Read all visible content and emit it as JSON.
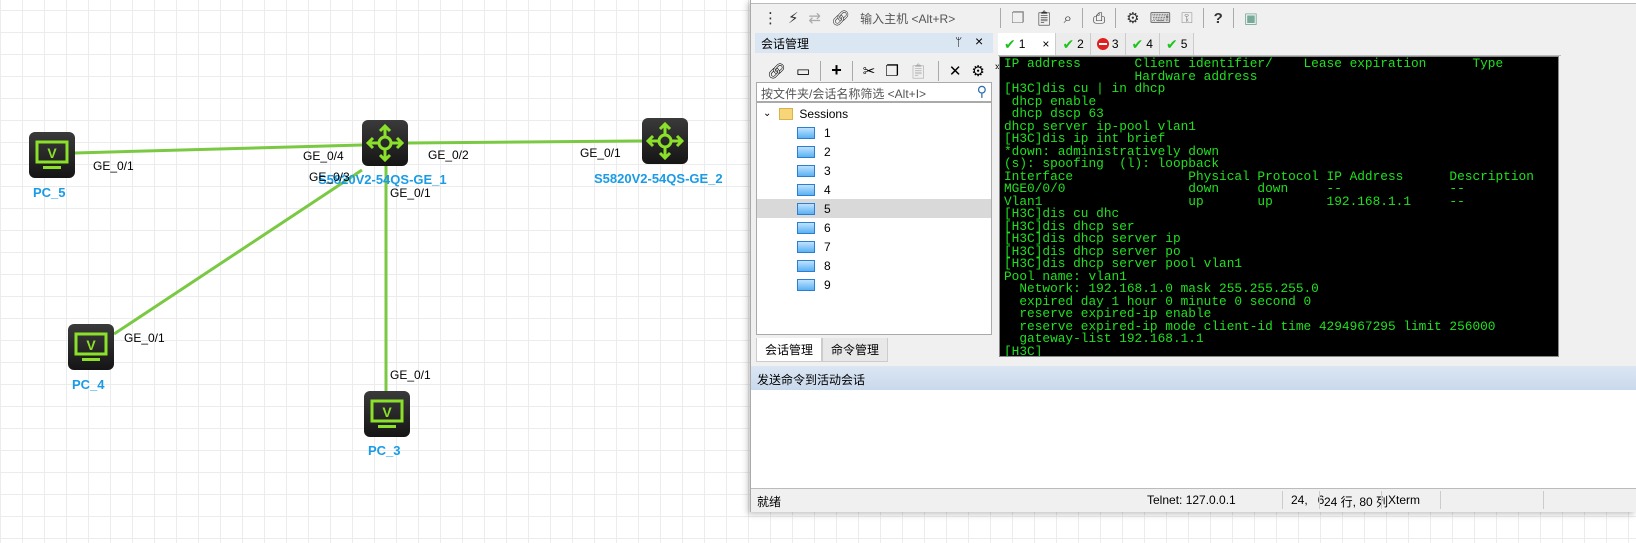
{
  "topology": {
    "nodes": [
      {
        "id": "pc5",
        "label": "PC_5",
        "type": "pc"
      },
      {
        "id": "sw1",
        "label": "S5820V2-54QS-GE_1",
        "type": "switch"
      },
      {
        "id": "sw2",
        "label": "S5820V2-54QS-GE_2",
        "type": "switch"
      },
      {
        "id": "pc4",
        "label": "PC_4",
        "type": "pc"
      },
      {
        "id": "pc3",
        "label": "PC_3",
        "type": "pc"
      }
    ],
    "ports": {
      "pc5": "GE_0/1",
      "sw1_pc5": "GE_0/4",
      "sw1_pc4": "GE_0/3",
      "sw1_sw2": "GE_0/2",
      "sw2": "GE_0/1",
      "sw1_pc3": "GE_0/1",
      "pc4": "GE_0/1",
      "pc3": "GE_0/1"
    },
    "link_color": "#7ac943"
  },
  "toolbar": {
    "host_placeholder": "输入主机 <Alt+R>"
  },
  "session_panel": {
    "title": "会话管理",
    "pin": "ᛘ",
    "close": "×",
    "more": "»",
    "filter_placeholder": "按文件夹/会话名称筛选 <Alt+I>",
    "root": "Sessions",
    "items": [
      "1",
      "2",
      "3",
      "4",
      "5",
      "6",
      "7",
      "8",
      "9"
    ],
    "selected": "5",
    "tabs": [
      "会话管理",
      "命令管理"
    ]
  },
  "tabs": [
    {
      "label": "1",
      "status": "ok",
      "close": "×"
    },
    {
      "label": "2",
      "status": "ok"
    },
    {
      "label": "3",
      "status": "error"
    },
    {
      "label": "4",
      "status": "ok"
    },
    {
      "label": "5",
      "status": "ok"
    }
  ],
  "terminal": {
    "lines": [
      "IP address       Client identifier/    Lease expiration      Type",
      "                 Hardware address",
      "[H3C]dis cu | in dhcp",
      " dhcp enable",
      " dhcp dscp 63",
      "dhcp server ip-pool vlan1",
      "[H3C]dis ip int brief",
      "*down: administratively down",
      "(s): spoofing  (l): loopback",
      "Interface               Physical Protocol IP Address      Description",
      "MGE0/0/0                down     down     --              --",
      "Vlan1                   up       up       192.168.1.1     --",
      "[H3C]dis cu dhc",
      "[H3C]dis dhcp ser",
      "[H3C]dis dhcp server ip",
      "[H3C]dis dhcp server po",
      "[H3C]dis dhcp server pool vlan1",
      "Pool name: vlan1",
      "  Network: 192.168.1.0 mask 255.255.255.0",
      "  expired day 1 hour 0 minute 0 second 0",
      "  reserve expired-ip enable",
      "  reserve expired-ip mode client-id time 4294967295 limit 256000",
      "  gateway-list 192.168.1.1",
      "[H3C]"
    ]
  },
  "send_bar": {
    "title": "发送命令到活动会话"
  },
  "statusbar": {
    "ready": "就绪",
    "connection": "Telnet: 127.0.0.1",
    "cursor": "24,   6",
    "size": "24 行, 80 列",
    "term_type": "Xterm"
  }
}
